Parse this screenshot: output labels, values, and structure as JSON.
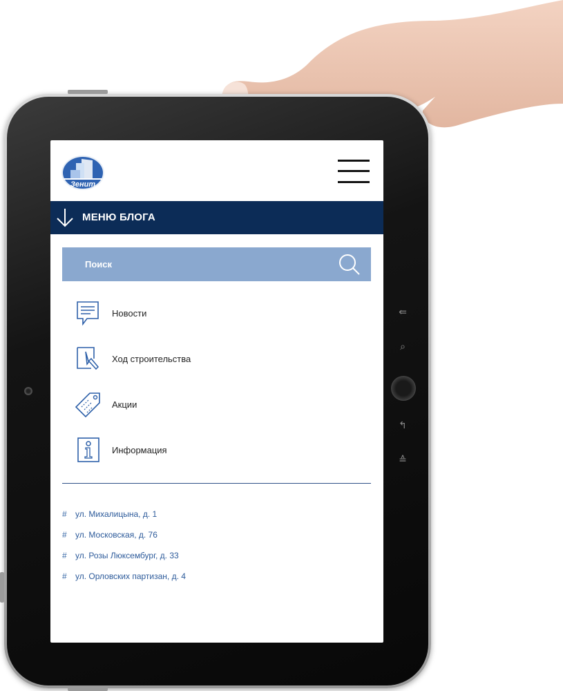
{
  "device": {
    "hardware_keys": {
      "back": "⇚",
      "search": "⌕",
      "return": "↰",
      "volume": "≙"
    }
  },
  "logo": {
    "text": "Зенит",
    "icon": "zenit-logo-icon"
  },
  "menu_bar": {
    "label": "МЕНЮ БЛОГА",
    "icon": "arrow-down-icon",
    "color": "#0c2c57"
  },
  "search": {
    "placeholder": "Поиск",
    "icon": "search-icon",
    "color": "#8aa8cf"
  },
  "nav": {
    "items": [
      {
        "label": "Новости",
        "icon": "news-document-icon"
      },
      {
        "label": "Ход строительства",
        "icon": "construction-progress-icon"
      },
      {
        "label": "Акции",
        "icon": "price-tag-icon"
      },
      {
        "label": "Информация",
        "icon": "info-icon"
      }
    ]
  },
  "addresses": {
    "hash": "#",
    "items": [
      "ул. Михалицына, д. 1",
      "ул. Московская, д. 76",
      "ул. Розы Люксембург, д. 33",
      "ул. Орловских партизан, д. 4"
    ]
  },
  "colors": {
    "accent": "#0c2c57",
    "link": "#2c5a9a",
    "icon": "#2c5fa8"
  }
}
